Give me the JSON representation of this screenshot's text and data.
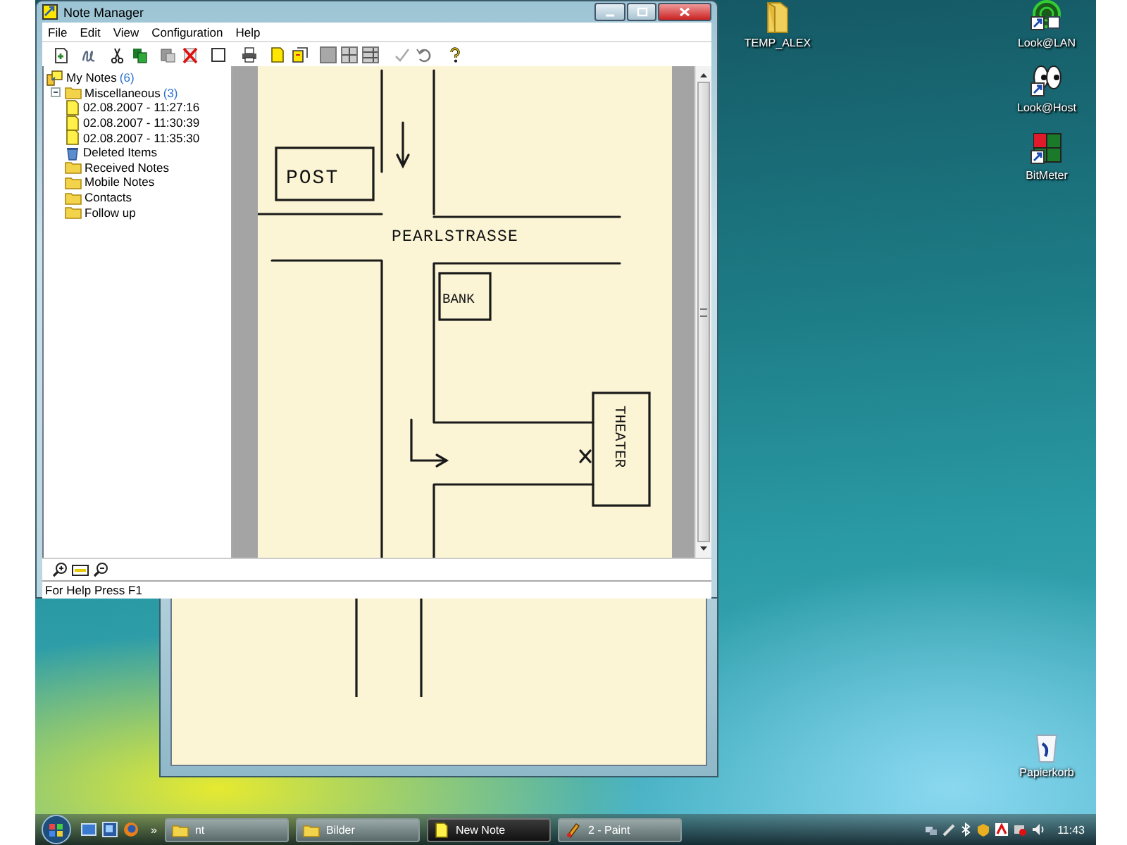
{
  "window": {
    "title": "Note Manager"
  },
  "menu": [
    "File",
    "Edit",
    "View",
    "Configuration",
    "Help"
  ],
  "tree": [
    {
      "label": "My Notes",
      "count": "(6)",
      "kind": "root",
      "children": [
        {
          "label": "Miscellaneous",
          "count": "(3)",
          "kind": "folder",
          "expanded": true,
          "children": [
            {
              "label": "02.08.2007 - 11:27:16",
              "kind": "note"
            },
            {
              "label": "02.08.2007 - 11:30:39",
              "kind": "note"
            },
            {
              "label": "02.08.2007 - 11:35:30",
              "kind": "note"
            }
          ]
        },
        {
          "label": "Deleted Items",
          "kind": "trash"
        },
        {
          "label": "Received Notes",
          "kind": "folder"
        },
        {
          "label": "Mobile Notes",
          "kind": "folder"
        },
        {
          "label": "Contacts",
          "kind": "folder"
        },
        {
          "label": "Follow up",
          "kind": "folder"
        }
      ]
    }
  ],
  "note": {
    "post_label": "POST",
    "street_label": "PEARLSTRASSE",
    "bank_label": "BANK",
    "theater_label": "THEATER"
  },
  "status_bar": "For Help Press F1",
  "desktop_icons": [
    {
      "label": "TEMP_ALEX",
      "kind": "folder"
    },
    {
      "label": "Look@LAN",
      "kind": "radar"
    },
    {
      "label": "Look@Host",
      "kind": "eyes"
    },
    {
      "label": "BitMeter",
      "kind": "meter"
    },
    {
      "label": "Papierkorb",
      "kind": "bin"
    }
  ],
  "taskbar": {
    "overflow": "»",
    "buttons": [
      {
        "label": "nt",
        "kind": "folder",
        "selected": false
      },
      {
        "label": "Bilder",
        "kind": "folder",
        "selected": false
      },
      {
        "label": "New Note",
        "kind": "note",
        "selected": true
      },
      {
        "label": "2 - Paint",
        "kind": "paint",
        "selected": false
      }
    ],
    "clock": "11:43"
  }
}
